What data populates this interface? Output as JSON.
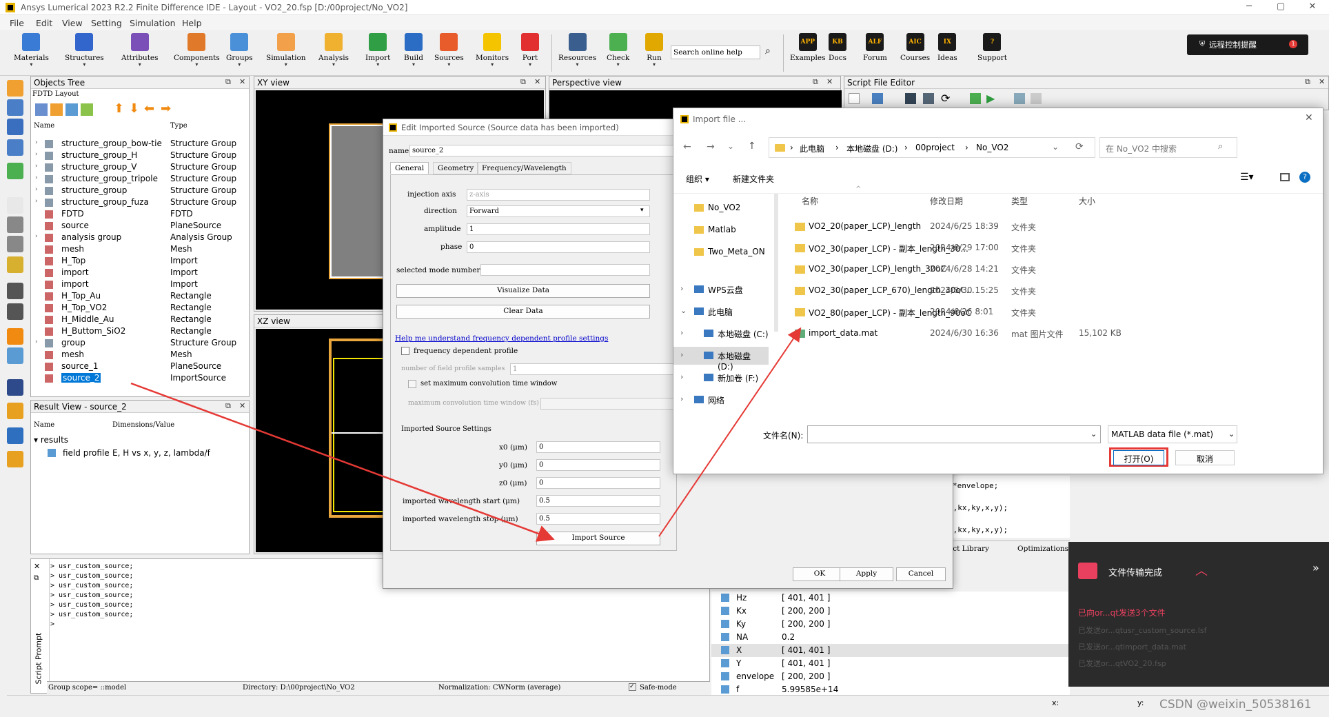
{
  "window": {
    "title": "Ansys Lumerical 2023 R2.2 Finite Difference IDE - Layout - VO2_20.fsp [D:/00project/No_VO2]",
    "minimize": "─",
    "maximize": "▢",
    "close": "✕"
  },
  "menu": [
    "File",
    "Edit",
    "View",
    "Setting",
    "Simulation",
    "Help"
  ],
  "toolbar": {
    "buttons": [
      {
        "label": "Materials",
        "color": "#3a7bd5"
      },
      {
        "label": "Structures",
        "color": "#3366cc"
      },
      {
        "label": "Attributes",
        "color": "#7b4fb8"
      },
      {
        "label": "Components",
        "color": "#e07a2a"
      },
      {
        "label": "Groups",
        "color": "#4a90d9"
      },
      {
        "label": "Simulation",
        "color": "#f2a04a"
      },
      {
        "label": "Analysis",
        "color": "#f0b030"
      },
      {
        "label": "Import",
        "color": "#2f9e44"
      },
      {
        "label": "Build",
        "color": "#2b6cc4"
      },
      {
        "label": "Sources",
        "color": "#e85c2c"
      },
      {
        "label": "Monitors",
        "color": "#f5c400"
      },
      {
        "label": "Port",
        "color": "#e23030"
      },
      {
        "label": "Resources",
        "color": "#3a5f8f"
      },
      {
        "label": "Check",
        "color": "#4caf50"
      },
      {
        "label": "Run",
        "color": "#e0a800"
      }
    ],
    "search_placeholder": "Search online help",
    "right_buttons": [
      {
        "label": "Examples",
        "text": "APP"
      },
      {
        "label": "Docs",
        "text": "KB"
      },
      {
        "label": "Forum",
        "text": "ALF"
      },
      {
        "label": "Courses",
        "text": "AIC"
      },
      {
        "label": "Ideas",
        "text": "IX"
      },
      {
        "label": "Support",
        "text": "?"
      }
    ],
    "remote_badge": "远程控制提醒",
    "remote_count": "1"
  },
  "objects_tree": {
    "title": "Objects Tree",
    "subtitle": "FDTD Layout",
    "col_name": "Name",
    "col_type": "Type",
    "rows": [
      {
        "name": "structure_group_bow-tie",
        "type": "Structure Group"
      },
      {
        "name": "structure_group_H",
        "type": "Structure Group"
      },
      {
        "name": "structure_group_V",
        "type": "Structure Group"
      },
      {
        "name": "structure_group_tripole",
        "type": "Structure Group"
      },
      {
        "name": "structure_group",
        "type": "Structure Group"
      },
      {
        "name": "structure_group_fuza",
        "type": "Structure Group"
      },
      {
        "name": "FDTD",
        "type": "FDTD"
      },
      {
        "name": "source",
        "type": "PlaneSource"
      },
      {
        "name": "analysis group",
        "type": "Analysis Group"
      },
      {
        "name": "mesh",
        "type": "Mesh"
      },
      {
        "name": "H_Top",
        "type": "Import"
      },
      {
        "name": "import",
        "type": "Import"
      },
      {
        "name": "import",
        "type": "Import"
      },
      {
        "name": "H_Top_Au",
        "type": "Rectangle"
      },
      {
        "name": "H_Top_VO2",
        "type": "Rectangle"
      },
      {
        "name": "H_Middle_Au",
        "type": "Rectangle"
      },
      {
        "name": "H_Buttom_SiO2",
        "type": "Rectangle"
      },
      {
        "name": "group",
        "type": "Structure Group"
      },
      {
        "name": "mesh",
        "type": "Mesh"
      },
      {
        "name": "source_1",
        "type": "PlaneSource"
      },
      {
        "name": "source_2",
        "type": "ImportSource"
      }
    ]
  },
  "result_view": {
    "title": "Result View - source_2",
    "col_name": "Name",
    "col_dim": "Dimensions/Value",
    "group": "results",
    "item_name": "field profile",
    "item_value": "E, H vs x, y, z, lambda/f"
  },
  "views": {
    "xy": "XY view",
    "xz": "XZ view",
    "perspective": "Perspective view",
    "script_editor": "Script File Editor"
  },
  "script_prompt": {
    "label": "Script Prompt",
    "lines": [
      "> usr_custom_source;",
      "> usr_custom_source;",
      "> usr_custom_source;",
      "> usr_custom_source;",
      "> usr_custom_source;",
      "> usr_custom_source;",
      ">"
    ]
  },
  "status": {
    "group_scope": "Group scope= ::model",
    "directory": "Directory: D:\\00project\\No_VO2",
    "normalization": "Normalization: CWNorm (average)",
    "safe_mode": "Safe-mode",
    "x": "x:",
    "y": "y:"
  },
  "edit_source": {
    "title": "Edit Imported Source (Source data has been imported)",
    "name_label": "name",
    "name_value": "source_2",
    "tabs": [
      "General",
      "Geometry",
      "Frequency/Wavelength"
    ],
    "injection_axis_label": "injection axis",
    "injection_axis_value": "z-axis",
    "direction_label": "direction",
    "direction_value": "Forward",
    "amplitude_label": "amplitude",
    "amplitude_value": "1",
    "phase_label": "phase",
    "phase_value": "0",
    "selected_mode_label": "selected mode number",
    "visualize": "Visualize Data",
    "clear": "Clear Data",
    "help_link": "Help me understand frequency dependent profile settings",
    "freq_dep": "frequency dependent profile",
    "num_samples_label": "number of field profile samples",
    "num_samples_value": "1",
    "set_max_conv": "set maximum convolution time window",
    "max_conv_label": "maximum convolution time window (fs)",
    "imported_settings": "Imported Source Settings",
    "x0_label": "x0 (μm)",
    "x0_value": "0",
    "y0_label": "y0 (μm)",
    "y0_value": "0",
    "z0_label": "z0 (μm)",
    "z0_value": "0",
    "wl_start_label": "imported wavelength start (μm)",
    "wl_start_value": "0.5",
    "wl_stop_label": "imported wavelength stop (μm)",
    "wl_stop_value": "0.5",
    "import_source": "Import Source",
    "ok": "OK",
    "apply": "Apply",
    "cancel": "Cancel"
  },
  "import_dialog": {
    "title": "Import file ...",
    "path": [
      "此电脑",
      "本地磁盘 (D:)",
      "00project",
      "No_VO2"
    ],
    "search_placeholder": "在 No_VO2 中搜索",
    "organize": "组织 ▾",
    "new_folder": "新建文件夹",
    "nav": [
      "No_VO2",
      "Matlab",
      "Two_Meta_ON",
      "WPS云盘",
      "此电脑",
      "本地磁盘 (C:)",
      "本地磁盘 (D:)",
      "新加卷 (F:)",
      "网络"
    ],
    "col_name": "名称",
    "col_date": "修改日期",
    "col_type": "类型",
    "col_size": "大小",
    "files": [
      {
        "name": "VO2_20(paper_LCP)_length",
        "date": "2024/6/25 18:39",
        "type": "文件夹",
        "size": ""
      },
      {
        "name": "VO2_30(paper_LCP) - 副本_length_30...",
        "date": "2024/6/29 17:00",
        "type": "文件夹",
        "size": ""
      },
      {
        "name": "VO2_30(paper_LCP)_length_30oC",
        "date": "2024/6/28 14:21",
        "type": "文件夹",
        "size": ""
      },
      {
        "name": "VO2_30(paper_LCP_670)_length_30oC...",
        "date": "2024/6/30 15:25",
        "type": "文件夹",
        "size": ""
      },
      {
        "name": "VO2_80(paper_LCP) - 副本_length_90oC",
        "date": "2024/6/26 8:01",
        "type": "文件夹",
        "size": ""
      },
      {
        "name": "import_data.mat",
        "date": "2024/6/30 16:36",
        "type": "mat 图片文件",
        "size": "15,102 KB"
      }
    ],
    "filename_label": "文件名(N):",
    "filetype": "MATLAB data file (*.mat)",
    "open": "打开(O)",
    "cancel": "取消"
  },
  "script_snippets": [
    "*envelope;",
    "x,kx,ky,x,y);",
    "x,kx,ky,x,y);"
  ],
  "bottom_tabs": [
    "ect Library",
    "Optimizations"
  ],
  "variables": [
    {
      "name": "Hz",
      "value": "[ 401, 401 ]"
    },
    {
      "name": "Kx",
      "value": "[ 200, 200 ]"
    },
    {
      "name": "Ky",
      "value": "[ 200, 200 ]"
    },
    {
      "name": "NA",
      "value": "0.2"
    },
    {
      "name": "X",
      "value": "[ 401, 401 ]"
    },
    {
      "name": "Y",
      "value": "[ 401, 401 ]"
    },
    {
      "name": "envelope",
      "value": "[ 200, 200 ]"
    },
    {
      "name": "f",
      "value": "5.99585e+14"
    }
  ],
  "transfer_popup": {
    "title": "文件传输完成",
    "line1": "已向or...qt发送3个文件",
    "line2": "已发送or...qtusr_custom_source.lsf",
    "line3": "已发送or...qtimport_data.mat",
    "line4": "已发送or...qtVO2_20.fsp"
  },
  "watermark": "CSDN @weixin_50538161",
  "colors": {
    "highlight": "#cce8ff",
    "red_annot": "#e53935",
    "accent": "#0078d4"
  }
}
